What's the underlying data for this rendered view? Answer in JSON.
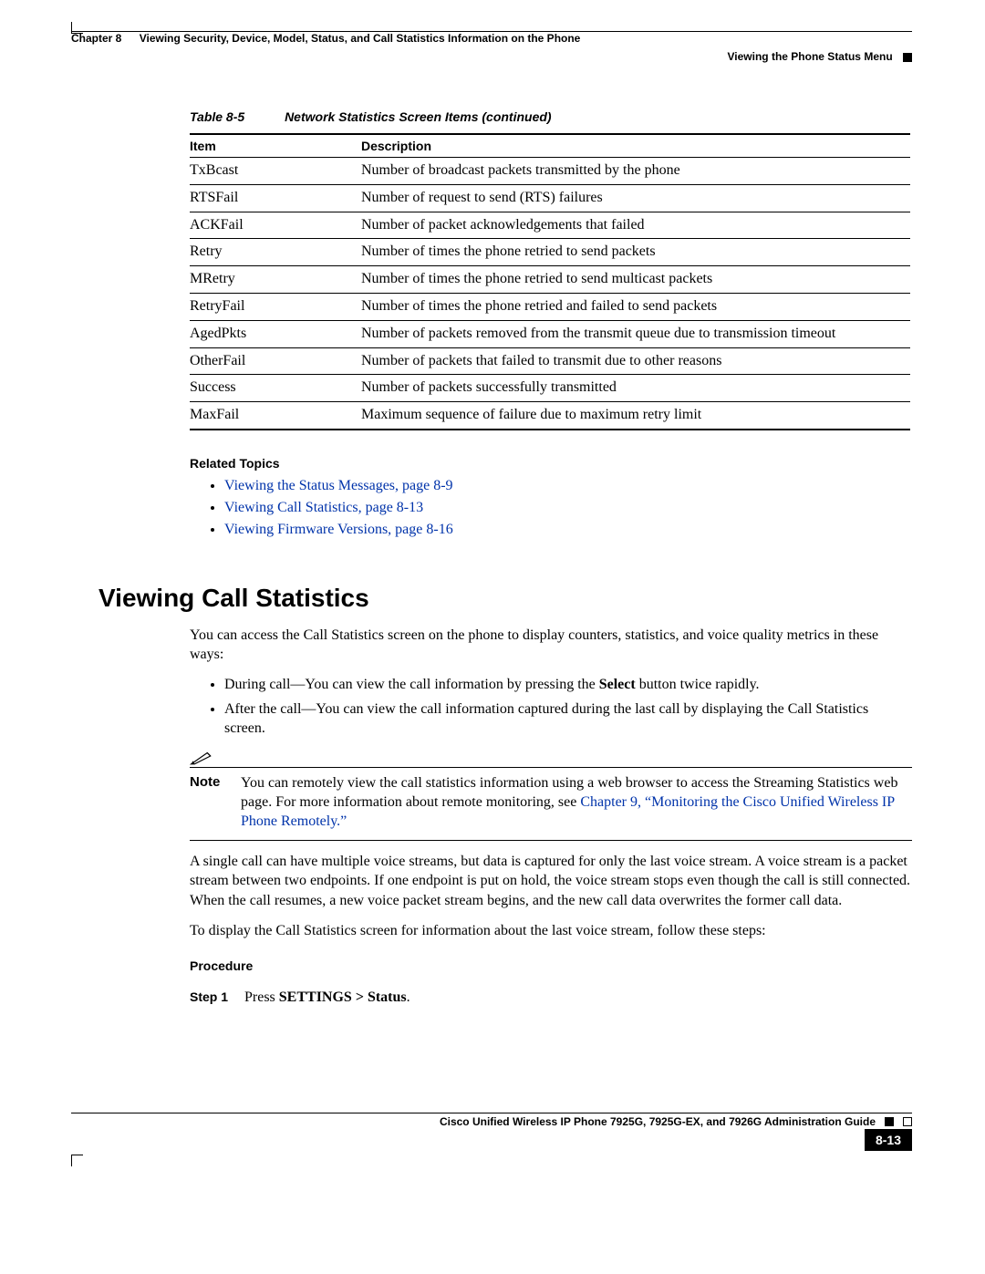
{
  "header": {
    "chapter_label": "Chapter 8",
    "chapter_title": "Viewing Security, Device, Model, Status, and Call Statistics Information on the Phone",
    "section_right": "Viewing the Phone Status Menu"
  },
  "table": {
    "number": "Table 8-5",
    "title": "Network Statistics Screen Items (continued)",
    "col_item": "Item",
    "col_desc": "Description",
    "rows": [
      {
        "item": "TxBcast",
        "desc": "Number of broadcast packets transmitted by the phone"
      },
      {
        "item": "RTSFail",
        "desc": "Number of request to send (RTS) failures"
      },
      {
        "item": "ACKFail",
        "desc": "Number of packet acknowledgements that failed"
      },
      {
        "item": "Retry",
        "desc": "Number of times the phone retried to send packets"
      },
      {
        "item": "MRetry",
        "desc": "Number of times the phone retried to send multicast packets"
      },
      {
        "item": "RetryFail",
        "desc": "Number of times the phone retried and failed to send packets"
      },
      {
        "item": "AgedPkts",
        "desc": "Number of packets removed from the transmit queue due to transmission timeout"
      },
      {
        "item": "OtherFail",
        "desc": "Number of packets that failed to transmit due to other reasons"
      },
      {
        "item": "Success",
        "desc": "Number of packets successfully transmitted"
      },
      {
        "item": "MaxFail",
        "desc": "Maximum sequence of failure due to maximum retry limit"
      }
    ]
  },
  "related": {
    "heading": "Related Topics",
    "links": [
      "Viewing the Status Messages, page 8-9",
      "Viewing Call Statistics, page 8-13",
      "Viewing Firmware Versions, page 8-16"
    ]
  },
  "section": {
    "heading": "Viewing Call Statistics",
    "intro": "You can access the Call Statistics screen on the phone to display counters, statistics, and voice quality metrics in these ways:",
    "bullet1_pre": "During call—You can view the call information by pressing the ",
    "bullet1_bold": "Select",
    "bullet1_post": " button twice rapidly.",
    "bullet2": "After the call—You can view the call information captured during the last call by displaying the Call Statistics screen.",
    "note_label": "Note",
    "note_text_pre": "You can remotely view the call statistics information using a web browser to access the Streaming Statistics web page. For more information about remote monitoring, see ",
    "note_link": "Chapter 9, “Monitoring the Cisco Unified Wireless IP Phone Remotely.”",
    "para2": "A single call can have multiple voice streams, but data is captured for only the last voice stream. A voice stream is a packet stream between two endpoints. If one endpoint is put on hold, the voice stream stops even though the call is still connected. When the call resumes, a new voice packet stream begins, and the new call data overwrites the former call data.",
    "para3": "To display the Call Statistics screen for information about the last voice stream, follow these steps:",
    "procedure_heading": "Procedure",
    "step1_label": "Step 1",
    "step1_pre": "Press ",
    "step1_bold": "SETTINGS > Status",
    "step1_post": "."
  },
  "footer": {
    "guide_title": "Cisco Unified Wireless IP Phone 7925G, 7925G-EX, and 7926G Administration Guide",
    "page_number": "8-13"
  }
}
